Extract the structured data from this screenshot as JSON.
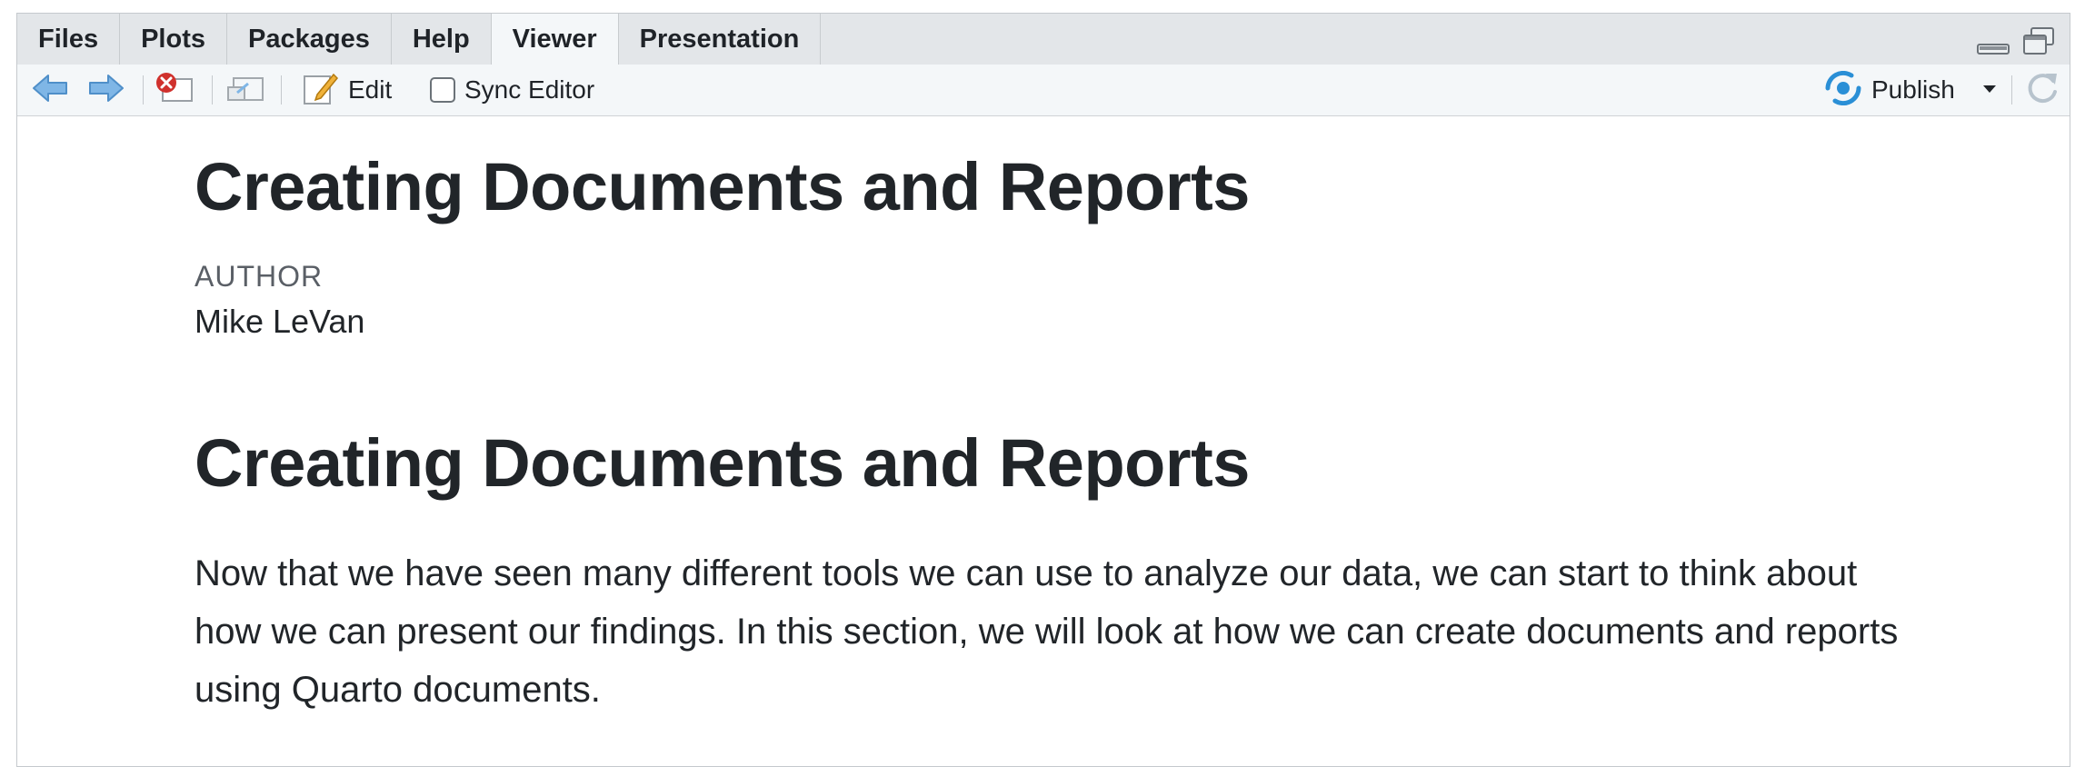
{
  "tabs": [
    {
      "label": "Files"
    },
    {
      "label": "Plots"
    },
    {
      "label": "Packages"
    },
    {
      "label": "Help"
    },
    {
      "label": "Viewer",
      "active": true
    },
    {
      "label": "Presentation"
    }
  ],
  "toolbar": {
    "back_icon": "arrow-left-icon",
    "forward_icon": "arrow-right-icon",
    "clear_icon": "remove-viewer-icon",
    "popout_icon": "show-in-new-window-icon",
    "edit_label": "Edit",
    "sync_editor_label": "Sync Editor",
    "sync_editor_checked": false,
    "publish_label": "Publish",
    "refresh_icon": "refresh-icon"
  },
  "colors": {
    "tab_bar": "#e3e6e9",
    "toolbar": "#f4f7f9",
    "text": "#212529",
    "publish_accent": "#2a8fd6",
    "arrow_blue": "#6aa9df",
    "close_red": "#d0312d"
  },
  "document": {
    "title": "Creating Documents and Reports",
    "author_label": "AUTHOR",
    "author_name": "Mike LeVan",
    "section_heading": "Creating Documents and Reports",
    "paragraph": "Now that we have seen many different tools we can use to analyze our data, we can start to think about how we can present our findings. In this section, we will look at how we can create documents and reports using Quarto documents."
  }
}
